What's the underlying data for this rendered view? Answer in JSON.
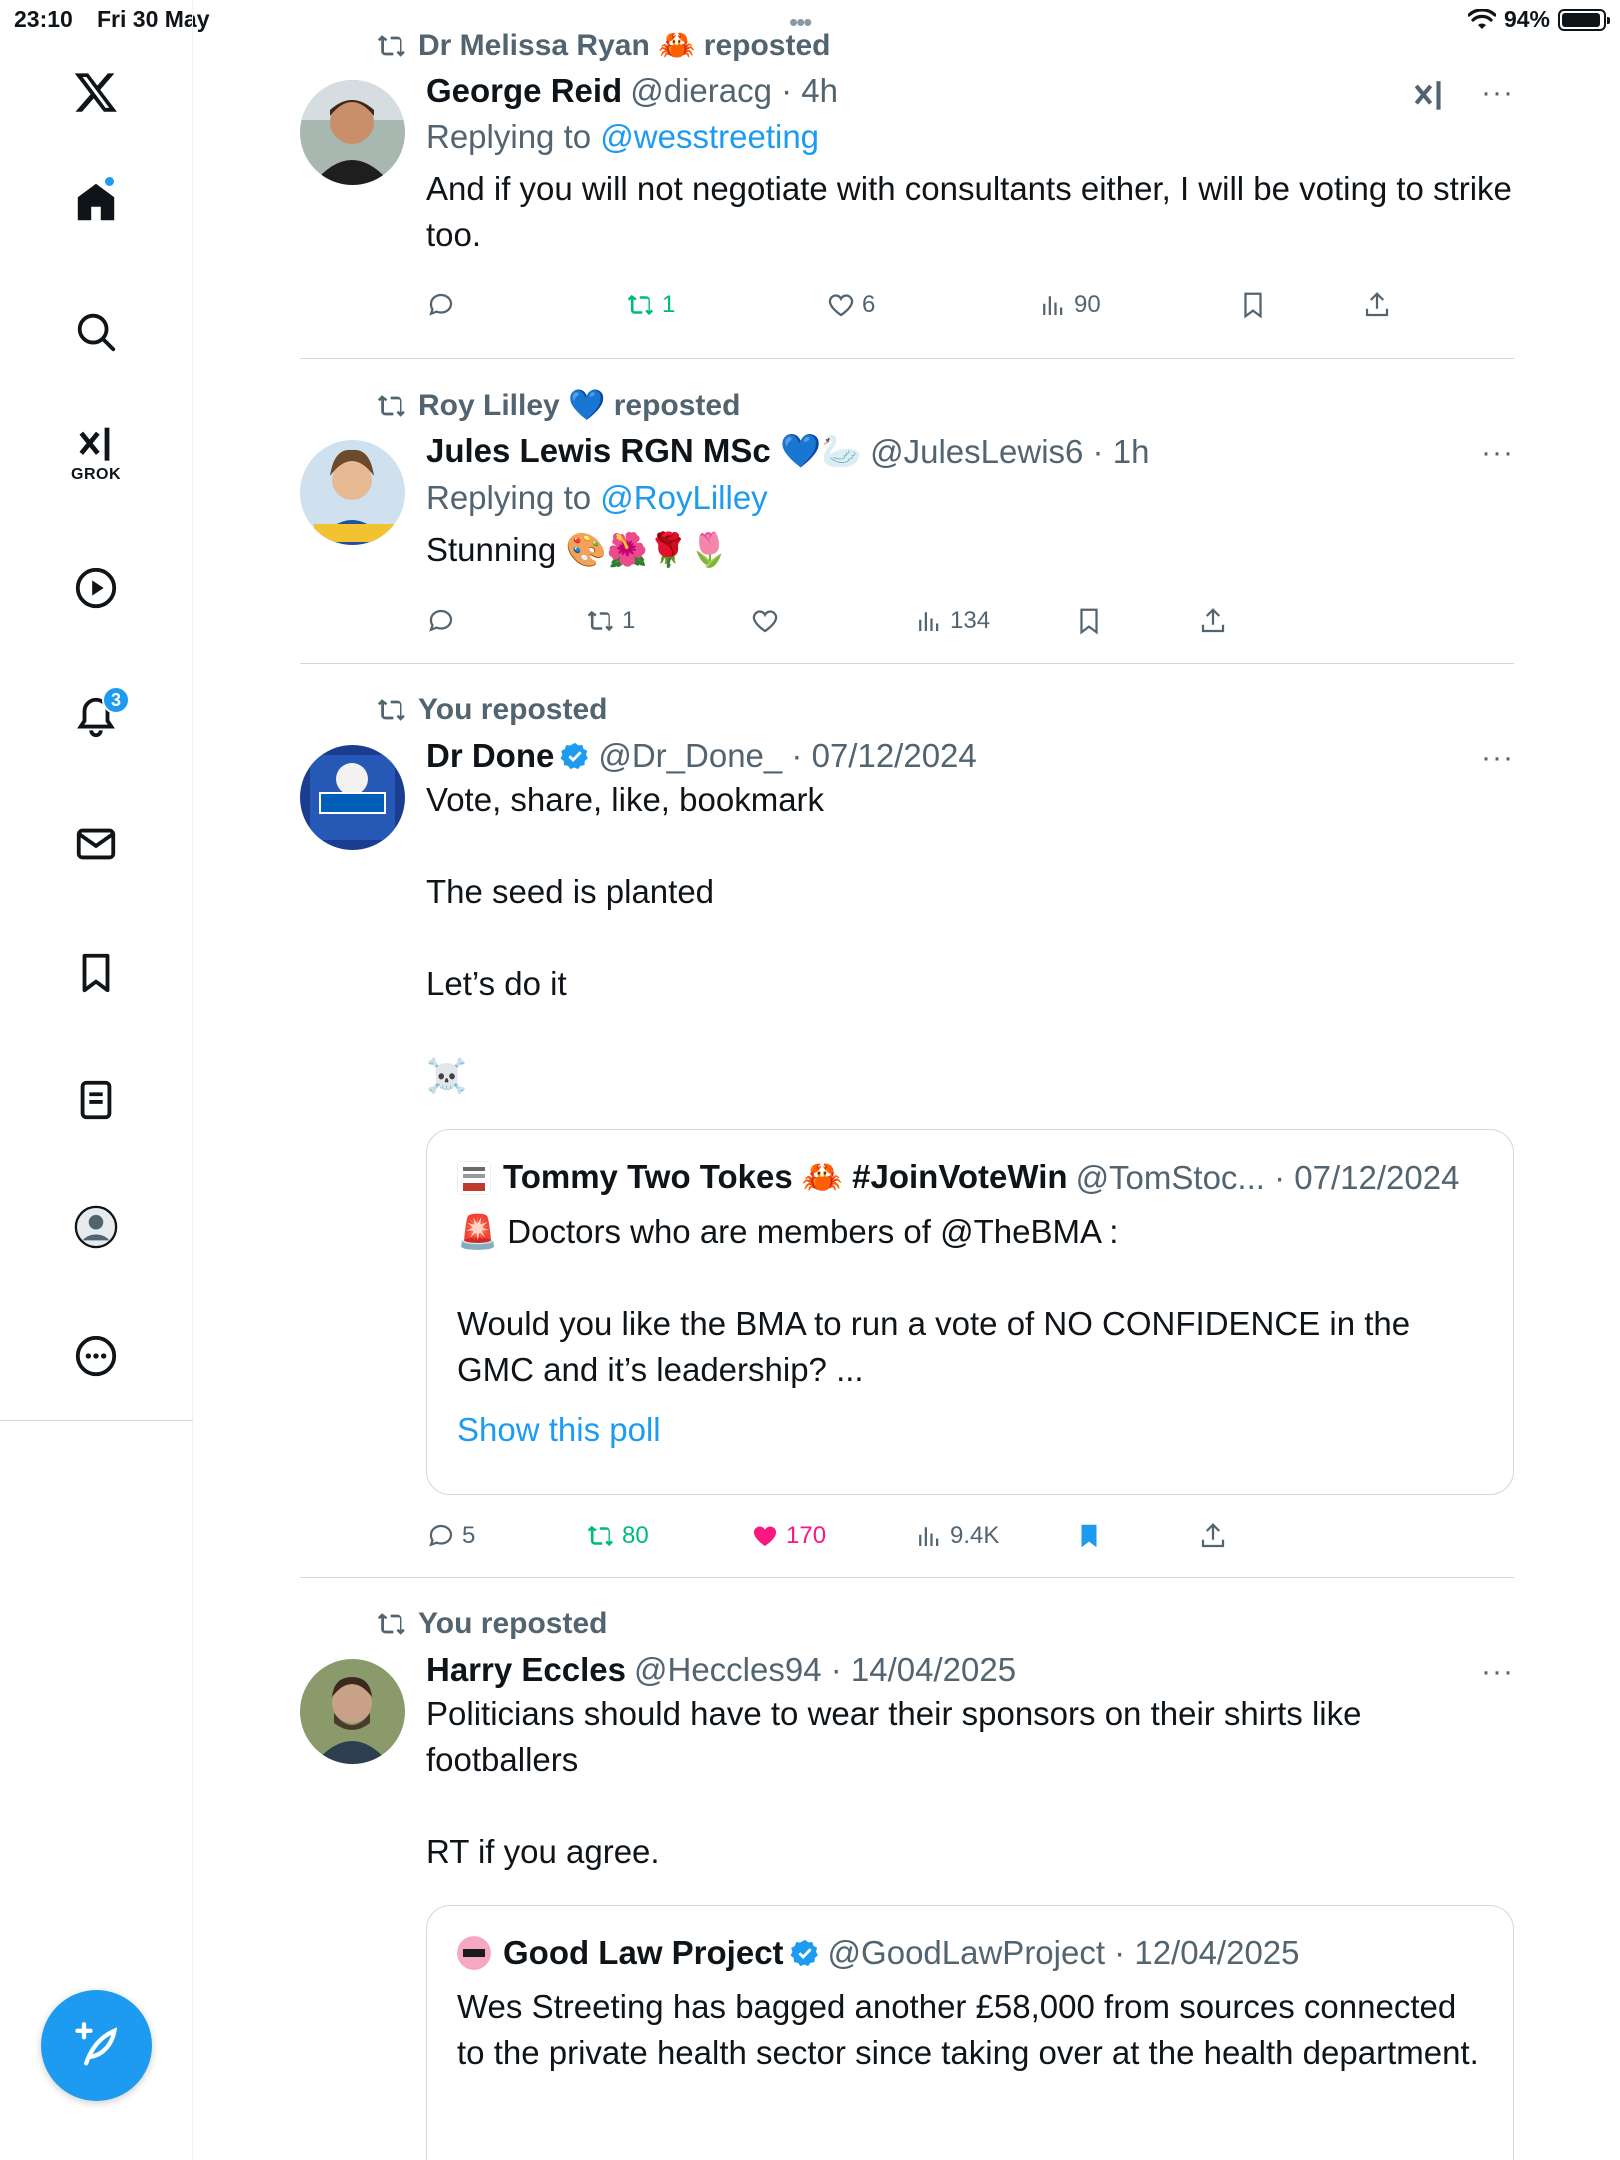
{
  "status_bar": {
    "time": "23:10",
    "date": "Fri 30 May",
    "battery": "94%",
    "battery_level": 0.94
  },
  "sidebar": {
    "grok_label": "GROK",
    "notifications_count": "3"
  },
  "colors": {
    "accent": "#1d9bf0",
    "retweet": "#00ba7c",
    "like": "#f91880",
    "secondary_text": "#536471"
  },
  "tweets": [
    {
      "reposted_by": "Dr Melissa Ryan 🦀 reposted",
      "name": "George Reid",
      "handle": "@dieracg · 4h",
      "reply_prefix": "Replying to",
      "reply_to": "@wesstreeting",
      "text": "And if you will not negotiate with consultants either, I will be voting to strike too.",
      "replies": "",
      "reposts": "1",
      "likes": "6",
      "views": "90"
    },
    {
      "reposted_by": "Roy Lilley 💙 reposted",
      "name": "Jules Lewis RGN MSc 💙🦢",
      "handle": "@JulesLewis6 · 1h",
      "reply_prefix": "Replying to",
      "reply_to": "@RoyLilley",
      "text": "Stunning 🎨🌺🌹🌷",
      "replies": "",
      "reposts": "1",
      "likes": "",
      "views": "134"
    },
    {
      "reposted_by": "You reposted",
      "name": "Dr Done",
      "handle": "@Dr_Done_ · 07/12/2024",
      "text": "Vote, share, like, bookmark\n\nThe seed is planted\n\nLet’s do it\n\n☠️",
      "quote": {
        "name": "Tommy Two Tokes 🦀 #JoinVoteWin",
        "handle": "@TomStoc... · 07/12/2024",
        "text": "🚨 Doctors who are members of @TheBMA :\n\nWould you like the BMA to run a vote of NO CONFIDENCE in the GMC and it’s leadership? ...",
        "link": "Show this poll"
      },
      "replies": "5",
      "reposts": "80",
      "likes": "170",
      "views": "9.4K"
    },
    {
      "reposted_by": "You reposted",
      "name": "Harry Eccles",
      "handle": "@Heccles94 · 14/04/2025",
      "text": "Politicians should have to wear their sponsors on their shirts like footballers\n\nRT if you agree.",
      "quote": {
        "name": "Good Law Project",
        "handle": "@GoodLawProject · 12/04/2025",
        "text": "Wes Streeting has bagged another £58,000 from sources connected to the private health sector since taking over at the health department."
      }
    }
  ]
}
